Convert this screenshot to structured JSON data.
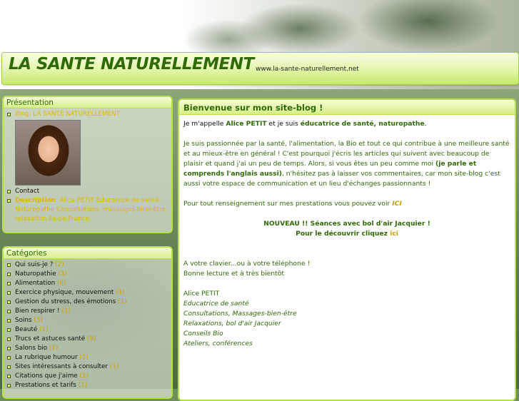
{
  "header": {
    "title": "LA SANTE NATURELLEMENT",
    "url": "www.la-sante-naturellement.net"
  },
  "presentation": {
    "heading": "Présentation",
    "blog_label": "Blog",
    "blog_name": ": LA SANTÉ NATURELLEMENT",
    "contact": "Contact",
    "description_label": "Description",
    "description_text": ": Alice PETIT Educatrice de santé-Naturopathe Consultations, massages-bien-être, relaxation Ile-de-France"
  },
  "categories": {
    "heading": "Catégories",
    "items": [
      {
        "name": "Qui suis-je ?",
        "count": "(2)"
      },
      {
        "name": "Naturopathie",
        "count": "(3)"
      },
      {
        "name": "Alimentation",
        "count": "(6)"
      },
      {
        "name": "Exercice physique, mouvement",
        "count": "(1)"
      },
      {
        "name": "Gestion du stress, des émotions",
        "count": "(1)"
      },
      {
        "name": "Bien respirer !",
        "count": "(1)"
      },
      {
        "name": "Soins",
        "count": "(3)"
      },
      {
        "name": "Beauté",
        "count": "(1)"
      },
      {
        "name": "Trucs et astuces santé",
        "count": "(9)"
      },
      {
        "name": "Salons bio",
        "count": "(1)"
      },
      {
        "name": "La rubrique humour",
        "count": "(1)"
      },
      {
        "name": "Sites intéressants à consulter",
        "count": "(1)"
      },
      {
        "name": "Citations que j'aime",
        "count": "(1)"
      },
      {
        "name": "Prestations et tarifs",
        "count": "(1)"
      }
    ]
  },
  "main": {
    "heading": "Bienvenue sur mon site-blog !",
    "intro_a": "Je m'appelle ",
    "intro_name": "Alice PETIT",
    "intro_b": " et je suis ",
    "intro_role": "éducatrice de santé, naturopathe",
    "intro_c": ".",
    "para2_a": "Je suis passionnée par la santé, l'alimentation, la Bio et tout ce qui contribue à une meilleure santé et au mieux-être en général !  C'est  pourquoi  j'écris les articles qui suivent avec beaucoup de plaisir et quand j'ai un peu de temps. Alors, si vous êtes un peu comme moi ",
    "para2_bold": "(je parle et comprends l'anglais aussi)",
    "para2_b": ", n'hésitez pas à laisser vos commentaires, car mon site-blog c'est aussi votre espace de communication et un lieu d'échanges passionnants !",
    "para3_text": "Pour tout renseignement sur mes prestations vous pouvez voir ",
    "para3_link": "ICI",
    "nouveau_line1": "NOUVEAU !! Séances avec bol d'air Jacquier !",
    "nouveau_line2": "Pour le découvrir cliquez ",
    "nouveau_link": "ici",
    "clavier_line1": "A votre clavier...ou à votre téléphone !",
    "clavier_line2": "Bonne lecture et à très bientôt",
    "sig_name": "Alice PETIT",
    "sig_lines": [
      "Educatrice de santé",
      "Consultations, Massages-bien-être",
      "Relaxations, bol d'air Jacquier",
      "Conseils Bio",
      "Ateliers, conférences"
    ]
  },
  "colors": {
    "title_green": "#2f6a06",
    "border_lime": "#b7e04a",
    "accent_yellow": "#e0b800"
  }
}
